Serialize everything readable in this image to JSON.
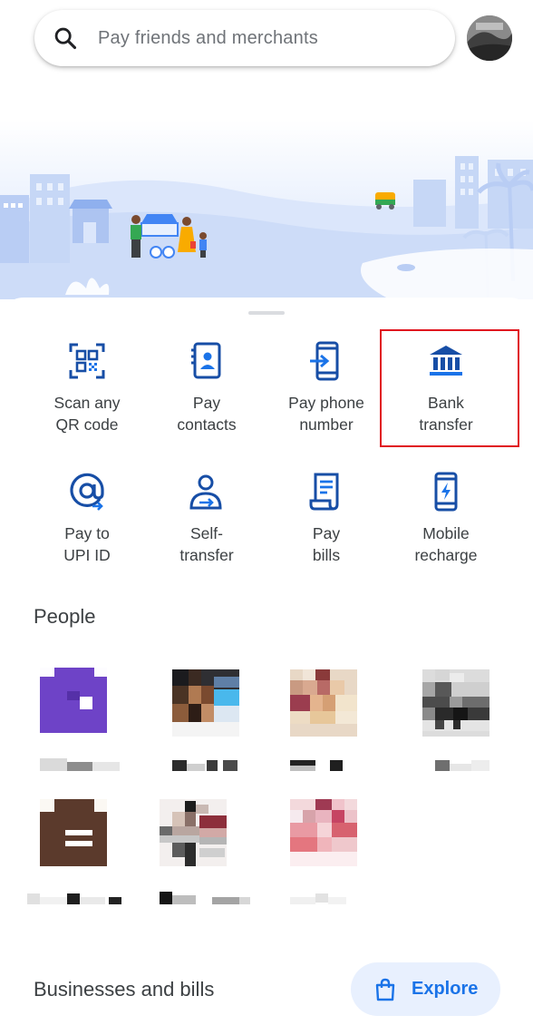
{
  "search": {
    "placeholder": "Pay friends and merchants"
  },
  "actions": [
    {
      "label": "Scan any\nQR code",
      "icon": "qr-code-icon"
    },
    {
      "label": "Pay\ncontacts",
      "icon": "contacts-icon"
    },
    {
      "label": "Pay phone\nnumber",
      "icon": "phone-icon"
    },
    {
      "label": "Bank\ntransfer",
      "icon": "bank-icon"
    },
    {
      "label": "Pay to\nUPI ID",
      "icon": "at-icon"
    },
    {
      "label": "Self-\ntransfer",
      "icon": "self-transfer-icon"
    },
    {
      "label": "Pay\nbills",
      "icon": "bill-icon"
    },
    {
      "label": "Mobile\nrecharge",
      "icon": "mobile-recharge-icon"
    }
  ],
  "people": {
    "title": "People"
  },
  "businesses": {
    "title": "Businesses and bills",
    "explore_label": "Explore"
  },
  "colors": {
    "accent": "#1a73e8",
    "icon_blue": "#174ea6",
    "highlight": "#e0141e"
  }
}
